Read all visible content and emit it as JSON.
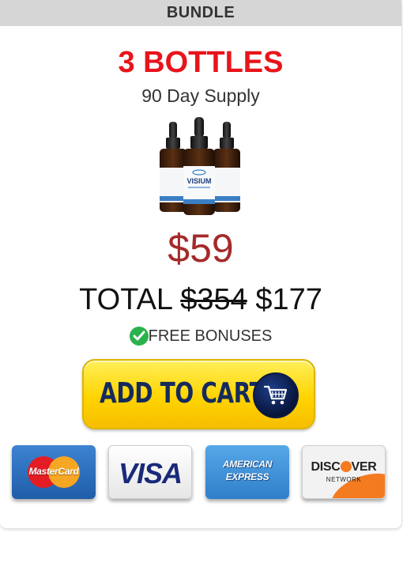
{
  "header": {
    "title": "BUNDLE"
  },
  "offer": {
    "quantity": "3 BOTTLES",
    "supply": "90 Day Supply",
    "price": "$59",
    "total_label": "TOTAL",
    "original_total": "$354",
    "total": "$177",
    "bonus": "FREE BONUSES",
    "product_label": "VISIUM"
  },
  "cta": {
    "label": "ADD TO CART"
  },
  "payment": {
    "mastercard": "MasterCard",
    "visa": "VISA",
    "amex_line1": "AMERICAN",
    "amex_line2": "EXPRESS",
    "discover_pre": "DISC",
    "discover_post": "VER",
    "discover_network": "NETWORK"
  },
  "colors": {
    "quantity_red": "#e8141b",
    "price_brown_red": "#a52a2a",
    "button_yellow": "#ffd400",
    "button_text_navy": "#152a5c",
    "check_green": "#2bb24c"
  }
}
